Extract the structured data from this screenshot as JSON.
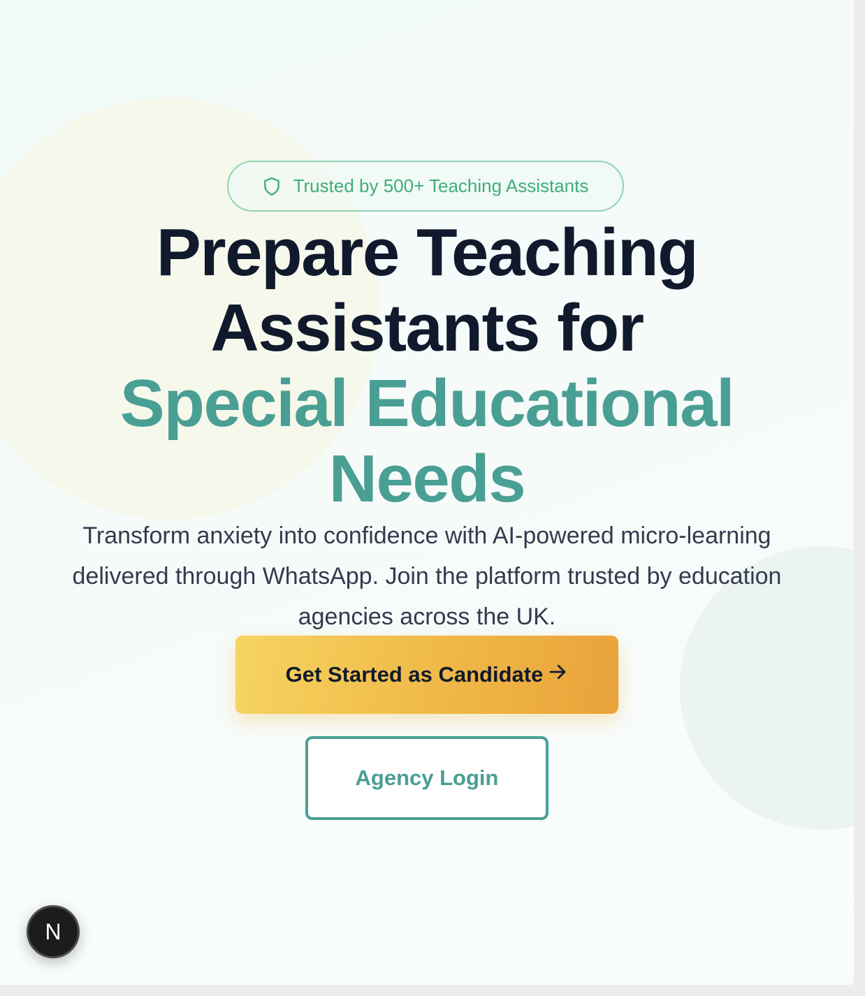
{
  "hero": {
    "badge_text": "Trusted by 500+ Teaching Assistants",
    "badge_icon": "shield-icon",
    "headline_line1": "Prepare Teaching",
    "headline_line2": "Assistants for",
    "headline_accent_line1": "Special Educational",
    "headline_accent_line2": "Needs",
    "subtitle": "Transform anxiety into confidence with AI-powered micro-learning delivered through WhatsApp. Join the platform trusted by education agencies across the UK."
  },
  "actions": {
    "primary_label": "Get Started as Candidate",
    "primary_icon": "arrow-right-icon",
    "secondary_label": "Agency Login"
  },
  "dev_indicator": {
    "label": "N"
  },
  "colors": {
    "accent_teal": "#4a9f94",
    "badge_green": "#3fae78",
    "heading_dark": "#111a2c",
    "cta_yellow_start": "#f6d460",
    "cta_orange_end": "#e9a23a"
  }
}
